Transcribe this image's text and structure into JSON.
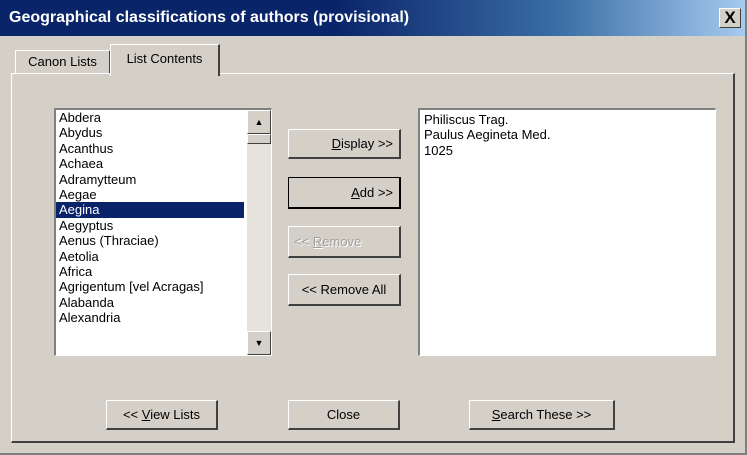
{
  "window": {
    "title": "Geographical classifications of authors (provisional)",
    "close_label": "X"
  },
  "tabs": [
    {
      "label": "Canon Lists",
      "active": false
    },
    {
      "label": "List Contents",
      "active": true
    }
  ],
  "locations": {
    "items": [
      "Abdera",
      "Abydus",
      "Acanthus",
      "Achaea",
      "Adramytteum",
      "Aegae",
      "Aegina",
      "Aegyptus",
      "Aenus (Thraciae)",
      "Aetolia",
      "Africa",
      "Agrigentum [vel Acragas]",
      "Alabanda",
      "Alexandria"
    ],
    "selected": "Aegina",
    "scroll_up_glyph": "▲",
    "scroll_down_glyph": "▼"
  },
  "contents": {
    "lines": [
      "Philiscus Trag.",
      "Paulus Aegineta Med.",
      "1025"
    ]
  },
  "buttons": {
    "display": {
      "label": "Display",
      "suffix": " >>",
      "mnemonic": "D",
      "rest": "isplay"
    },
    "add": {
      "label": "Add",
      "mnemonic": "A",
      "rest": "dd",
      "suffix": " >>"
    },
    "remove": {
      "prefix": "<< ",
      "mnemonic": "R",
      "rest": "emove",
      "enabled": false
    },
    "remove_all": {
      "label": "<< Remove All"
    },
    "view_lists": {
      "prefix": "<< ",
      "mnemonic": "V",
      "rest": "iew Lists"
    },
    "close": {
      "label": "Close"
    },
    "search_these": {
      "mnemonic": "S",
      "rest": "earch These",
      "suffix": " >>"
    }
  }
}
